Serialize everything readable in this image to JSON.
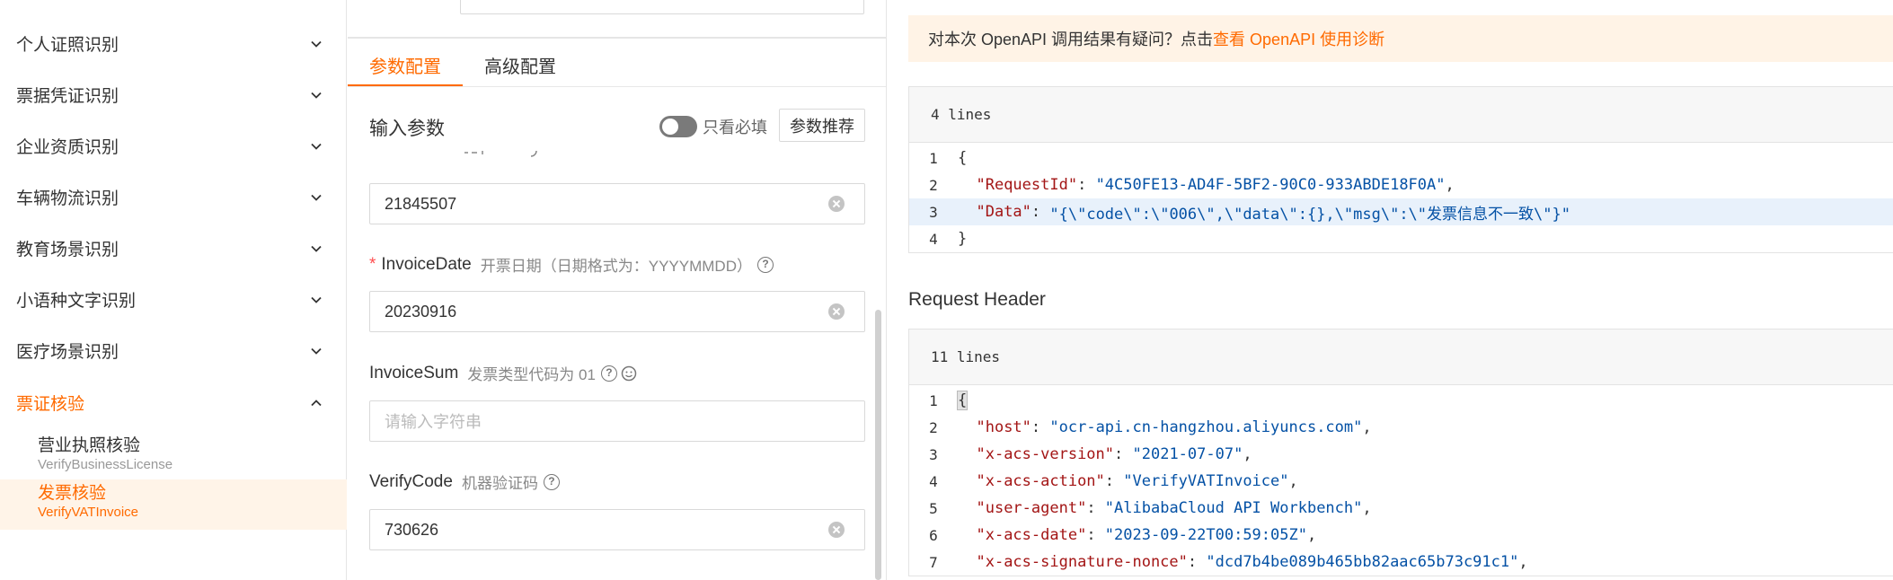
{
  "sidebar": {
    "categories": [
      {
        "label": "个人证照识别"
      },
      {
        "label": "票据凭证识别"
      },
      {
        "label": "企业资质识别"
      },
      {
        "label": "车辆物流识别"
      },
      {
        "label": "教育场景识别"
      },
      {
        "label": "小语种文字识别"
      },
      {
        "label": "医疗场景识别"
      },
      {
        "label": "票证核验"
      }
    ],
    "sub_items": [
      {
        "cn": "营业执照核验",
        "en": "VerifyBusinessLicense"
      },
      {
        "cn": "发票核验",
        "en": "VerifyVATInvoice"
      }
    ]
  },
  "middle": {
    "tabs": [
      "参数配置",
      "高级配置"
    ],
    "section_title": "输入参数",
    "toggle_label": "只看必填",
    "recommend_button": "参数推荐",
    "fields": {
      "invoice_no_value": "21845507",
      "invoice_date": {
        "required": "*",
        "name": "InvoiceDate",
        "desc": "开票日期（日期格式为：YYYYMMDD）",
        "value": "20230916"
      },
      "invoice_sum": {
        "name": "InvoiceSum",
        "desc": "发票类型代码为 01",
        "placeholder": "请输入字符串"
      },
      "verify_code": {
        "name": "VerifyCode",
        "desc": "机器验证码",
        "value": "730626"
      }
    },
    "help_glyph": "?"
  },
  "right": {
    "notice_text": "对本次 OpenAPI 调用结果有疑问？点击",
    "notice_link": "查看 OpenAPI 使用诊断",
    "response": {
      "lines_label": "4 lines",
      "lines": [
        {
          "n": "1",
          "brace": "{"
        },
        {
          "n": "2",
          "key": "\"RequestId\"",
          "val": "\"4C50FE13-AD4F-5BF2-90C0-933ABDE18F0A\"",
          "comma": ","
        },
        {
          "n": "3",
          "key": "\"Data\"",
          "val": "\"{\\\"code\\\":\\\"006\\\",\\\"data\\\":{},\\\"msg\\\":\\\"发票信息不一致\\\"}\"",
          "comma": ""
        },
        {
          "n": "4",
          "brace": "}"
        }
      ]
    },
    "request_header_title": "Request Header",
    "header": {
      "lines_label": "11 lines",
      "lines": [
        {
          "n": "1",
          "brace": "{"
        },
        {
          "n": "2",
          "key": "\"host\"",
          "val": "\"ocr-api.cn-hangzhou.aliyuncs.com\"",
          "comma": ","
        },
        {
          "n": "3",
          "key": "\"x-acs-version\"",
          "val": "\"2021-07-07\"",
          "comma": ","
        },
        {
          "n": "4",
          "key": "\"x-acs-action\"",
          "val": "\"VerifyVATInvoice\"",
          "comma": ","
        },
        {
          "n": "5",
          "key": "\"user-agent\"",
          "val": "\"AlibabaCloud API Workbench\"",
          "comma": ","
        },
        {
          "n": "6",
          "key": "\"x-acs-date\"",
          "val": "\"2023-09-22T00:59:05Z\"",
          "comma": ","
        },
        {
          "n": "7",
          "key": "\"x-acs-signature-nonce\"",
          "val": "\"dcd7b4be089b465bb82aac65b73c91c1\"",
          "comma": ","
        }
      ]
    }
  },
  "colors": {
    "accent": "#ff6a00",
    "notice_bg": "#fff3e6",
    "selected_bg": "#fff4e8",
    "json_key": "#a31515",
    "json_string": "#0451a5"
  }
}
